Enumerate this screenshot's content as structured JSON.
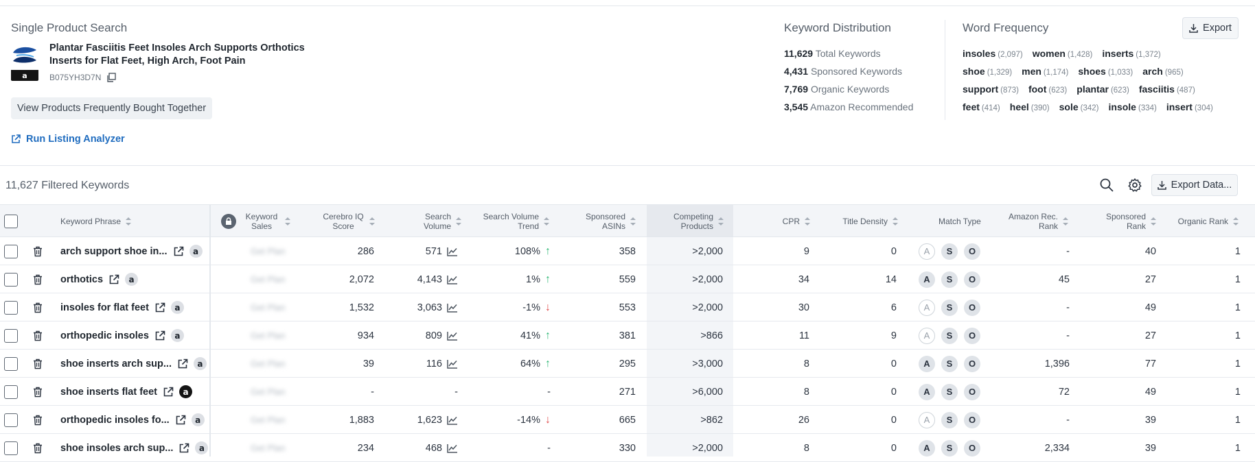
{
  "product_panel": {
    "heading": "Single Product Search",
    "title": "Plantar Fasciitis Feet Insoles Arch Supports Orthotics Inserts for Flat Feet, High Arch, Foot Pain",
    "asin": "B075YH3D7N",
    "fbt_button": "View Products Frequently Bought Together",
    "run_listing_analyzer": "Run Listing Analyzer"
  },
  "keyword_distribution": {
    "heading": "Keyword Distribution",
    "rows": [
      {
        "value": "11,629",
        "label": "Total Keywords"
      },
      {
        "value": "4,431",
        "label": "Sponsored Keywords"
      },
      {
        "value": "7,769",
        "label": "Organic Keywords"
      },
      {
        "value": "3,545",
        "label": "Amazon Recommended"
      }
    ]
  },
  "word_frequency": {
    "heading": "Word Frequency",
    "export_label": "Export",
    "rows": [
      [
        {
          "word": "insoles",
          "count": "(2,097)"
        },
        {
          "word": "women",
          "count": "(1,428)"
        },
        {
          "word": "inserts",
          "count": "(1,372)"
        }
      ],
      [
        {
          "word": "shoe",
          "count": "(1,329)"
        },
        {
          "word": "men",
          "count": "(1,174)"
        },
        {
          "word": "shoes",
          "count": "(1,033)"
        },
        {
          "word": "arch",
          "count": "(965)"
        }
      ],
      [
        {
          "word": "support",
          "count": "(873)"
        },
        {
          "word": "foot",
          "count": "(623)"
        },
        {
          "word": "plantar",
          "count": "(623)"
        },
        {
          "word": "fasciitis",
          "count": "(487)"
        }
      ],
      [
        {
          "word": "feet",
          "count": "(414)"
        },
        {
          "word": "heel",
          "count": "(390)"
        },
        {
          "word": "sole",
          "count": "(342)"
        },
        {
          "word": "insole",
          "count": "(334)"
        },
        {
          "word": "insert",
          "count": "(304)"
        }
      ]
    ]
  },
  "toolbar": {
    "filtered_count": "11,627 Filtered Keywords",
    "export_data_label": "Export Data..."
  },
  "table": {
    "headers": {
      "keyword_phrase": "Keyword Phrase",
      "keyword_sales": "Keyword Sales",
      "cerebro_iq": "Cerebro IQ Score",
      "search_volume": "Search Volume",
      "sv_trend": "Search Volume Trend",
      "sponsored_asins": "Sponsored ASINs",
      "competing": "Competing Products",
      "cpr": "CPR",
      "title_density": "Title Density",
      "match_type": "Match Type",
      "amazon_rec_rank": "Amazon Rec. Rank",
      "sponsored_rank": "Sponsored Rank",
      "organic_rank": "Organic Rank"
    },
    "sales_placeholder": "Get Plan",
    "rows": [
      {
        "kw": "arch support shoe in...",
        "amz_dark": false,
        "iq": "286",
        "sv": "571",
        "sv_chart": true,
        "trend": "108%",
        "trend_dir": "up",
        "sponsored_asins": "358",
        "competing": ">2,000",
        "cpr": "9",
        "title_density": "0",
        "match": [
          false,
          true,
          true
        ],
        "amz_rank": "-",
        "spon_rank": "40",
        "org_rank": "1"
      },
      {
        "kw": "orthotics",
        "amz_dark": false,
        "iq": "2,072",
        "sv": "4,143",
        "sv_chart": true,
        "trend": "1%",
        "trend_dir": "up",
        "sponsored_asins": "559",
        "competing": ">2,000",
        "cpr": "34",
        "title_density": "14",
        "match": [
          true,
          true,
          true
        ],
        "amz_rank": "45",
        "spon_rank": "27",
        "org_rank": "1"
      },
      {
        "kw": "insoles for flat feet",
        "amz_dark": false,
        "iq": "1,532",
        "sv": "3,063",
        "sv_chart": true,
        "trend": "-1%",
        "trend_dir": "down",
        "sponsored_asins": "553",
        "competing": ">2,000",
        "cpr": "30",
        "title_density": "6",
        "match": [
          false,
          true,
          true
        ],
        "amz_rank": "-",
        "spon_rank": "49",
        "org_rank": "1"
      },
      {
        "kw": "orthopedic insoles",
        "amz_dark": false,
        "iq": "934",
        "sv": "809",
        "sv_chart": true,
        "trend": "41%",
        "trend_dir": "up",
        "sponsored_asins": "381",
        "competing": ">866",
        "cpr": "11",
        "title_density": "9",
        "match": [
          false,
          true,
          true
        ],
        "amz_rank": "-",
        "spon_rank": "27",
        "org_rank": "1"
      },
      {
        "kw": "shoe inserts arch sup...",
        "amz_dark": false,
        "iq": "39",
        "sv": "116",
        "sv_chart": true,
        "trend": "64%",
        "trend_dir": "up",
        "sponsored_asins": "295",
        "competing": ">3,000",
        "cpr": "8",
        "title_density": "0",
        "match": [
          true,
          true,
          true
        ],
        "amz_rank": "1,396",
        "spon_rank": "77",
        "org_rank": "1"
      },
      {
        "kw": "shoe inserts flat feet",
        "amz_dark": true,
        "iq": "-",
        "sv": "-",
        "sv_chart": false,
        "trend": "-",
        "trend_dir": "none",
        "sponsored_asins": "271",
        "competing": ">6,000",
        "cpr": "8",
        "title_density": "0",
        "match": [
          true,
          true,
          true
        ],
        "amz_rank": "72",
        "spon_rank": "49",
        "org_rank": "1"
      },
      {
        "kw": "orthopedic insoles fo...",
        "amz_dark": false,
        "iq": "1,883",
        "sv": "1,623",
        "sv_chart": true,
        "trend": "-14%",
        "trend_dir": "down",
        "sponsored_asins": "665",
        "competing": ">862",
        "cpr": "26",
        "title_density": "0",
        "match": [
          false,
          true,
          true
        ],
        "amz_rank": "-",
        "spon_rank": "39",
        "org_rank": "1"
      },
      {
        "kw": "shoe insoles arch sup...",
        "amz_dark": false,
        "iq": "234",
        "sv": "468",
        "sv_chart": true,
        "trend": "-",
        "trend_dir": "none",
        "sponsored_asins": "330",
        "competing": ">2,000",
        "cpr": "8",
        "title_density": "0",
        "match": [
          true,
          true,
          true
        ],
        "amz_rank": "2,334",
        "spon_rank": "39",
        "org_rank": "1"
      }
    ],
    "match_letters": [
      "A",
      "S",
      "O"
    ]
  },
  "colors": {
    "accent_link": "#1f6cbf",
    "trend_up": "#2bb673",
    "trend_down": "#e04a4a"
  }
}
